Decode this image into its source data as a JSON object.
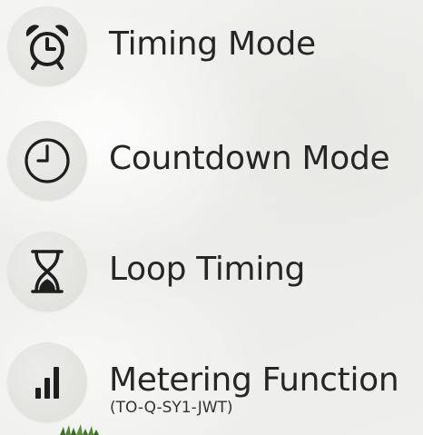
{
  "features": [
    {
      "label": "Timing Mode",
      "icon": "alarm-clock-icon"
    },
    {
      "label": "Countdown Mode",
      "icon": "clock-icon"
    },
    {
      "label": "Loop Timing",
      "icon": "hourglass-icon"
    },
    {
      "label": "Metering Function",
      "sublabel": "(TO-Q-SY1-JWT)",
      "icon": "bar-chart-icon"
    }
  ],
  "colors": {
    "text": "#262626",
    "icon": "#1e1e1e",
    "icon_disc": "#e2e2df",
    "background": "#f1f1ef"
  }
}
